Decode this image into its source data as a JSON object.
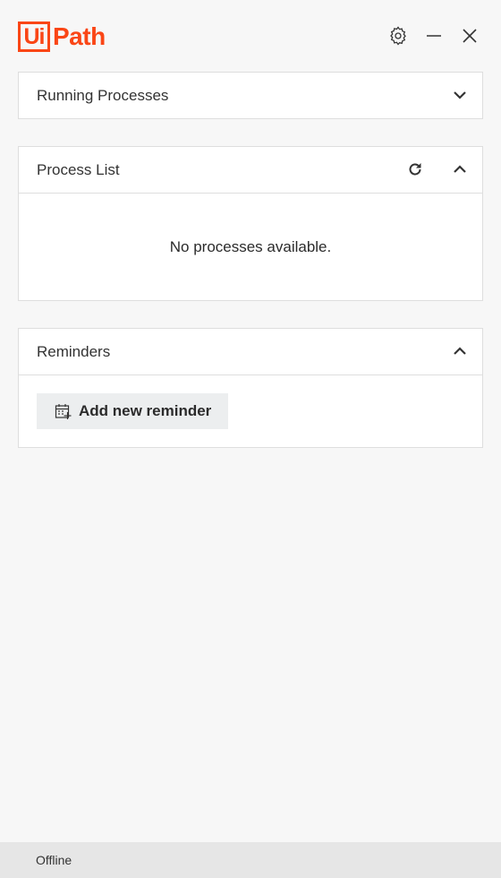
{
  "app": {
    "logo_box_text": "Ui",
    "logo_rest_text": "Path",
    "brand_color": "#fa4616"
  },
  "titlebar": {
    "settings_icon": "gear-icon",
    "minimize_icon": "minimize-icon",
    "close_icon": "close-icon"
  },
  "panels": {
    "running": {
      "title": "Running Processes",
      "toggle_icon": "chevron-down-icon"
    },
    "process_list": {
      "title": "Process List",
      "refresh_icon": "refresh-icon",
      "toggle_icon": "chevron-up-icon",
      "empty_message": "No processes available."
    },
    "reminders": {
      "title": "Reminders",
      "toggle_icon": "chevron-up-icon",
      "add_button_label": "Add new reminder",
      "add_button_icon": "calendar-add-icon"
    }
  },
  "status": {
    "text": "Offline"
  }
}
